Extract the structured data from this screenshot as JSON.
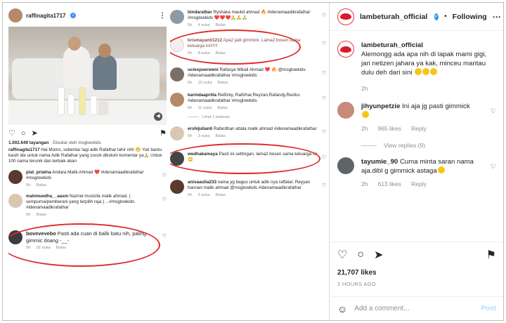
{
  "left": {
    "username": "raffinagita1717",
    "views": "1.002.649 tayangan",
    "liked_by": "Disukai oleh msglowkids",
    "caption_user": "raffinagita1717",
    "caption": "Hai Moms, sebentar lagi adik Rafathar lahir nih! 😁 Yuk bantu kasih ide untuk nama Adik Rafathar yang cocok dikolom komentar ya🙏 Untuk 100 nama terunik dan terbaik akan",
    "comments": [
      {
        "user": "piat_priatna",
        "text": "Andara Malik Ahmad ❤️ #idenamaadikrafathar #msglowkids",
        "time": "5h",
        "likes": "",
        "reply": "Balas"
      },
      {
        "user": "mahmuedha__aasm",
        "text": "Nazriel mustofa malik ahmad. ( sempurna/pemberani yang terpilih raja ) ...#msglowkids #idenamaadikrafathar",
        "time": "5h",
        "likes": "",
        "reply": "Balas"
      },
      {
        "user": "bovevevebo",
        "text": "Pasti ada cuan di balik batu nih, paling gimmic doang -__-",
        "time": "5h",
        "likes": "32 suka",
        "reply": "Balas"
      }
    ]
  },
  "middle": {
    "comments": [
      {
        "user": "bindaratbar",
        "text": "Ryshaka maulid ahmad 🔥 #idenamaadikrafathar #msglowkids ❤️❤️❤️🙏🙏🙏",
        "time": "5h",
        "likes": "4 suka",
        "reply": "Balas"
      },
      {
        "user": "krismayanti1212",
        "text": "Apa2 jadi gimmick. Lama2 bosen sama keluarga ini!!!!!!",
        "time": "5h",
        "likes": "8 suka",
        "reply": "Balas"
      },
      {
        "user": "uciexpoerweni",
        "text": "Rafasya Mikail Ahmad ❤️ 🔥 @msglowkids #idenamaadikrafathar #msglowkids",
        "time": "5h",
        "likes": "10 suka",
        "reply": "Balas"
      },
      {
        "user": "karindaaprilia",
        "text": "Reifizky, Rafizhar,Reyzan,Rafandy,Reizko #idenamaadikrafathar #msglowkids",
        "time": "5h",
        "likes": "11 suka",
        "reply": "Balas"
      },
      {
        "user": "ershijulianti",
        "text": "Rafardhan attala malik ahmad #idenamaadikrafathar",
        "time": "5h",
        "likes": "3 suka",
        "reply": "Balas"
      },
      {
        "user": "wedhakamaya",
        "text": "Pasti ini settingan, lama2 bosen sama keluarga ini 🙄",
        "time": "5h",
        "likes": "",
        "reply": ""
      },
      {
        "user": "anisaaulia233",
        "text": "nama yg bagus untuk adik nya raffatar. Reyyan hannan malik ahmad @msglowkids #idenamaadikrafathar",
        "time": "5h",
        "likes": "3 suka",
        "reply": "Balas"
      }
    ],
    "see_replies": "Lihat 1 balasan"
  },
  "right": {
    "username": "lambeturah_official",
    "follow_dot": "•",
    "following": "Following",
    "caption_user": "lambeturah_official",
    "caption": "Alemongg ada apa nih di lapak mami gigi, jari netizen jahara ya kak, minceu mantau dulu deh dari sini",
    "caption_time": "2h",
    "comments": [
      {
        "user": "jihyunpetzie",
        "text": "Ini aja jg pasti gimmick",
        "time": "2h",
        "likes": "965 likes",
        "reply": "Reply"
      },
      {
        "user": "tayumie_90",
        "text": "Cuma minta saran nama aja.dibl g gimmick astaga",
        "time": "2h",
        "likes": "613 likes",
        "reply": "Reply"
      }
    ],
    "view_replies": "View replies (9)",
    "likes": "21,707 likes",
    "time_ago": "2 HOURS AGO",
    "add_comment_placeholder": "Add a comment...",
    "post_label": "Post"
  }
}
